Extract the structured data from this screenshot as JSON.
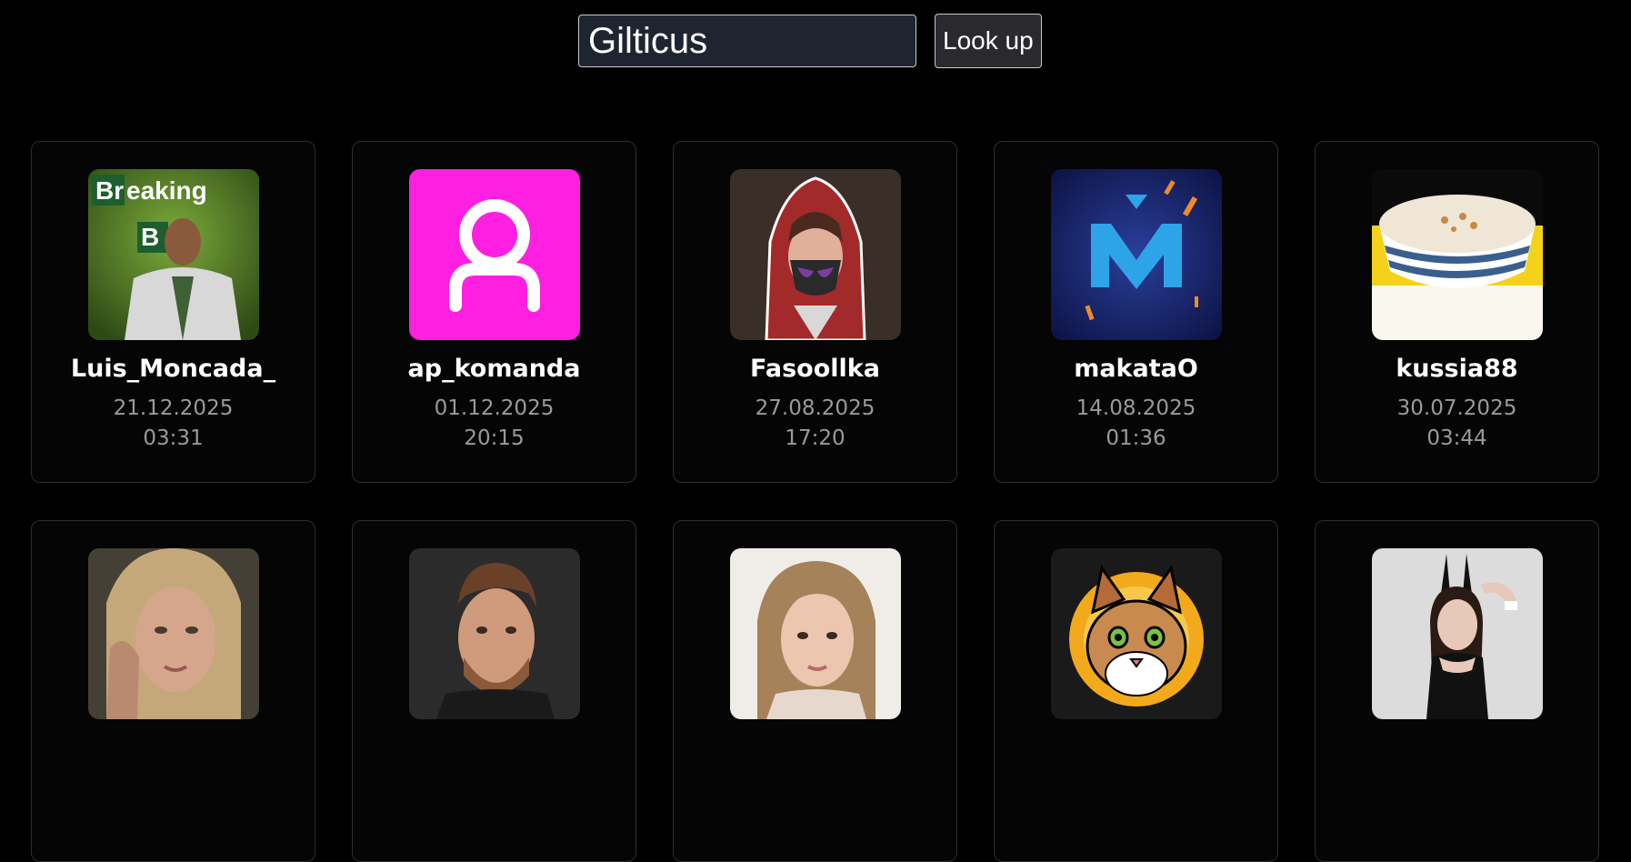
{
  "search": {
    "value": "Gilticus",
    "button_label": "Look up"
  },
  "cards": [
    {
      "name": "Luis_Moncada_",
      "date": "21.12.2025",
      "time": "03:31",
      "avatar": "breaking-bad-man-avatar"
    },
    {
      "name": "ap_komanda",
      "date": "01.12.2025",
      "time": "20:15",
      "avatar": "default-user-avatar"
    },
    {
      "name": "Fasoollka",
      "date": "27.08.2025",
      "time": "17:20",
      "avatar": "hooded-masked-girl-avatar"
    },
    {
      "name": "makataO",
      "date": "14.08.2025",
      "time": "01:36",
      "avatar": "blue-m-logo-avatar"
    },
    {
      "name": "kussia88",
      "date": "30.07.2025",
      "time": "03:44",
      "avatar": "porridge-bowl-avatar"
    },
    {
      "avatar": "blonde-woman-avatar"
    },
    {
      "avatar": "man-portrait-avatar"
    },
    {
      "avatar": "woman-selfie-avatar"
    },
    {
      "avatar": "cat-sun-avatar"
    },
    {
      "avatar": "bunny-costume-woman-avatar"
    }
  ],
  "colors": {
    "background": "#000000",
    "input_background": "#1f2530",
    "card_border": "#2d2d2d",
    "muted_text": "#9a9a9a",
    "pink_avatar": "#ff1fe0"
  }
}
